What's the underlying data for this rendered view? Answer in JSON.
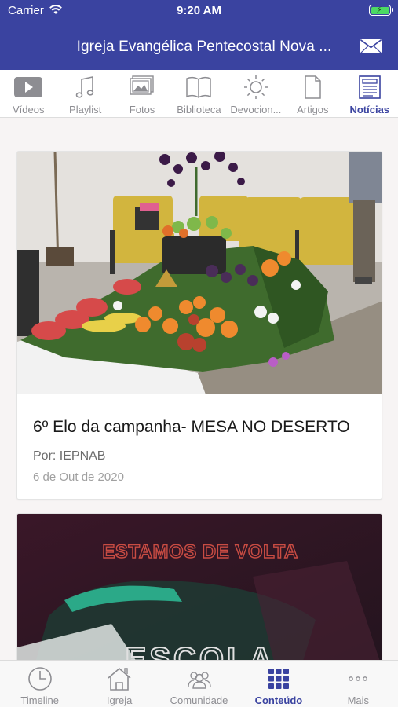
{
  "status_bar": {
    "carrier": "Carrier",
    "time": "9:20 AM"
  },
  "header": {
    "title": "Igreja Evangélica Pentecostal Nova ..."
  },
  "tabs": [
    {
      "label": "Vídeos",
      "icon": "video-play-icon",
      "active": false
    },
    {
      "label": "Playlist",
      "icon": "music-note-icon",
      "active": false
    },
    {
      "label": "Fotos",
      "icon": "photos-icon",
      "active": false
    },
    {
      "label": "Biblioteca",
      "icon": "book-icon",
      "active": false
    },
    {
      "label": "Devocion...",
      "icon": "sun-icon",
      "active": false
    },
    {
      "label": "Artigos",
      "icon": "document-icon",
      "active": false
    },
    {
      "label": "Notícias",
      "icon": "news-icon",
      "active": true
    }
  ],
  "posts": [
    {
      "title": "6º Elo da campanha- MESA NO DESERTO",
      "author": "Por: IEPNAB",
      "date": "6 de Out de 2020"
    },
    {
      "image_text_top": "ESTAMOS DE VOLTA",
      "image_text_bottom": "ESCOLA"
    }
  ],
  "bottom_nav": [
    {
      "label": "Timeline",
      "icon": "clock-icon",
      "active": false
    },
    {
      "label": "Igreja",
      "icon": "church-icon",
      "active": false
    },
    {
      "label": "Comunidade",
      "icon": "community-icon",
      "active": false
    },
    {
      "label": "Conteúdo",
      "icon": "grid-icon",
      "active": true
    },
    {
      "label": "Mais",
      "icon": "more-dots-icon",
      "active": false
    }
  ],
  "colors": {
    "primary": "#3a43a0",
    "inactive": "#8d8d92",
    "battery": "#4cd964"
  }
}
